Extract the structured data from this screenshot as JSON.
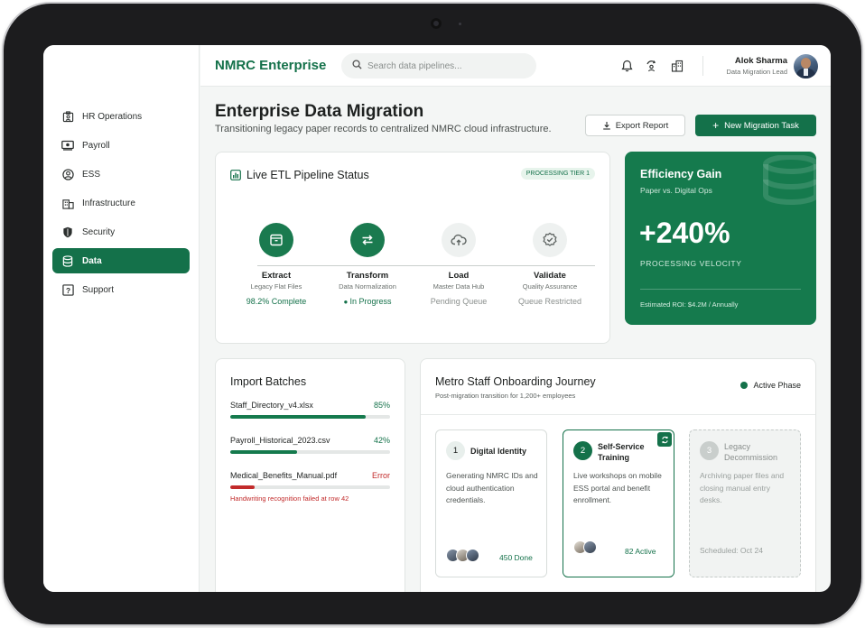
{
  "app": {
    "brand": "NMRC Enterprise"
  },
  "search": {
    "placeholder": "Search data pipelines..."
  },
  "user": {
    "name": "Alok Sharma",
    "role": "Data Migration Lead"
  },
  "sidebar": {
    "items": [
      {
        "label": "HR Operations",
        "icon": "hr-icon"
      },
      {
        "label": "Payroll",
        "icon": "payroll-icon"
      },
      {
        "label": "ESS",
        "icon": "ess-icon"
      },
      {
        "label": "Infrastructure",
        "icon": "infrastructure-icon"
      },
      {
        "label": "Security",
        "icon": "shield-icon"
      },
      {
        "label": "Data",
        "icon": "database-icon",
        "active": true
      },
      {
        "label": "Support",
        "icon": "help-icon"
      }
    ]
  },
  "page": {
    "title": "Enterprise Data Migration",
    "subtitle": "Transitioning legacy paper records to centralized NMRC cloud infrastructure.",
    "export_label": "Export Report",
    "new_task_label": "New Migration Task"
  },
  "etl": {
    "title": "Live ETL Pipeline Status",
    "tier": "PROCESSING TIER 1",
    "steps": [
      {
        "name": "Extract",
        "desc": "Legacy Flat Files",
        "status": "98.2% Complete"
      },
      {
        "name": "Transform",
        "desc": "Data Normalization",
        "status": "In Progress"
      },
      {
        "name": "Load",
        "desc": "Master Data Hub",
        "status": "Pending Queue"
      },
      {
        "name": "Validate",
        "desc": "Quality Assurance",
        "status": "Queue Restricted"
      }
    ]
  },
  "efficiency": {
    "title": "Efficiency Gain",
    "subtitle": "Paper vs. Digital Ops",
    "value": "+240%",
    "label": "PROCESSING VELOCITY",
    "roi": "Estimated ROI: $4.2M / Annually"
  },
  "imports": {
    "title": "Import Batches",
    "batches": [
      {
        "file": "Staff_Directory_v4.xlsx",
        "pct": "85%",
        "progress": 0.85
      },
      {
        "file": "Payroll_Historical_2023.csv",
        "pct": "42%",
        "progress": 0.42
      },
      {
        "file": "Medical_Benefits_Manual.pdf",
        "pct": "Error",
        "progress": 0.15,
        "error": "Handwriting recognition failed at row 42"
      }
    ]
  },
  "journey": {
    "title": "Metro Staff Onboarding Journey",
    "subtitle": "Post-migration transition for 1,200+ employees",
    "phase": "Active Phase",
    "cards": [
      {
        "num": "1",
        "title": "Digital Identity",
        "body": "Generating NMRC IDs and cloud authentication credentials.",
        "footer": "450 Done"
      },
      {
        "num": "2",
        "title": "Self-Service Training",
        "body": "Live workshops on mobile ESS portal and benefit enrollment.",
        "footer": "82 Active"
      },
      {
        "num": "3",
        "title": "Legacy Decommission",
        "body": "Archiving paper files and closing manual entry desks.",
        "footer": "Scheduled: Oct 24"
      }
    ]
  },
  "colors": {
    "accent": "#14714a",
    "error": "#c22b2b",
    "muted": "#8a8f8d"
  }
}
